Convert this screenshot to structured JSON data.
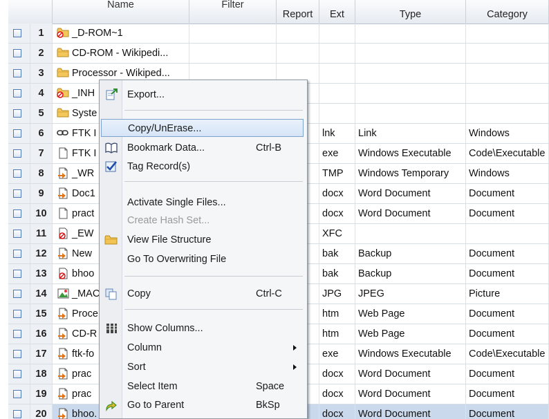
{
  "columns": {
    "name": "Name",
    "filter": "Filter",
    "report": "Report",
    "ext": "Ext",
    "type": "Type",
    "category": "Category"
  },
  "rows": [
    {
      "num": "1",
      "name": "_D-ROM~1",
      "ext": "",
      "type": "",
      "category": "",
      "icon": "deleted-folder-icon"
    },
    {
      "num": "2",
      "name": "CD-ROM - Wikipedi...",
      "ext": "",
      "type": "",
      "category": "",
      "icon": "folder-icon"
    },
    {
      "num": "3",
      "name": "Processor - Wikiped...",
      "ext": "",
      "type": "",
      "category": "",
      "icon": "folder-icon"
    },
    {
      "num": "4",
      "name": "_INH",
      "ext": "",
      "type": "",
      "category": "",
      "icon": "deleted-folder-icon"
    },
    {
      "num": "5",
      "name": "Syste",
      "ext": "",
      "type": "",
      "category": "",
      "icon": "folder-icon"
    },
    {
      "num": "6",
      "name": "FTK I",
      "ext": "lnk",
      "type": "Link",
      "category": "Windows",
      "icon": "link-icon"
    },
    {
      "num": "7",
      "name": "FTK I",
      "ext": "exe",
      "type": "Windows Executable",
      "category": "Code\\Executable",
      "icon": "file-icon"
    },
    {
      "num": "8",
      "name": "_WR",
      "ext": "TMP",
      "type": "Windows Temporary",
      "category": "Windows",
      "icon": "file-arrow-icon"
    },
    {
      "num": "9",
      "name": "Doc1",
      "ext": "docx",
      "type": "Word Document",
      "category": "Document",
      "icon": "file-arrow-icon"
    },
    {
      "num": "10",
      "name": "pract",
      "ext": "docx",
      "type": "Word Document",
      "category": "Document",
      "icon": "file-icon"
    },
    {
      "num": "11",
      "name": "_EW",
      "ext": "XFC",
      "type": "",
      "category": "",
      "icon": "deleted-file-icon"
    },
    {
      "num": "12",
      "name": "New",
      "ext": "bak",
      "type": "Backup",
      "category": "Document",
      "icon": "file-arrow-icon"
    },
    {
      "num": "13",
      "name": "bhoo",
      "ext": "bak",
      "type": "Backup",
      "category": "Document",
      "icon": "deleted-file-icon"
    },
    {
      "num": "14",
      "name": "_MAC",
      "ext": "JPG",
      "type": "JPEG",
      "category": "Picture",
      "icon": "picture-icon"
    },
    {
      "num": "15",
      "name": "Proce",
      "ext": "htm",
      "type": "Web Page",
      "category": "Document",
      "icon": "file-arrow-icon"
    },
    {
      "num": "16",
      "name": "CD-R",
      "ext": "htm",
      "type": "Web Page",
      "category": "Document",
      "icon": "file-arrow-icon"
    },
    {
      "num": "17",
      "name": "ftk-fo",
      "ext": "exe",
      "type": "Windows Executable",
      "category": "Code\\Executable",
      "icon": "file-arrow-icon"
    },
    {
      "num": "18",
      "name": "prac",
      "ext": "docx",
      "type": "Word Document",
      "category": "Document",
      "icon": "file-arrow-icon"
    },
    {
      "num": "19",
      "name": "prac",
      "ext": "docx",
      "type": "Word Document",
      "category": "Document",
      "icon": "file-arrow-icon"
    },
    {
      "num": "20",
      "name": "bhoo.",
      "ext": "docx",
      "type": "Word Document",
      "category": "Document",
      "icon": "file-arrow-icon",
      "selected": true
    }
  ],
  "menu": {
    "export": "Export...",
    "copy_unerase": "Copy/UnErase...",
    "bookmark": "Bookmark Data...",
    "bookmark_shortcut": "Ctrl-B",
    "tag": "Tag Record(s)",
    "activate": "Activate Single Files...",
    "create_hash": "Create Hash Set...",
    "view_structure": "View File Structure",
    "go_overwriting": "Go To Overwriting File",
    "copy": "Copy",
    "copy_shortcut": "Ctrl-C",
    "show_columns": "Show Columns...",
    "column": "Column",
    "sort": "Sort",
    "select_item": "Select Item",
    "select_item_shortcut": "Space",
    "go_parent": "Go to Parent",
    "go_parent_shortcut": "BkSp"
  }
}
